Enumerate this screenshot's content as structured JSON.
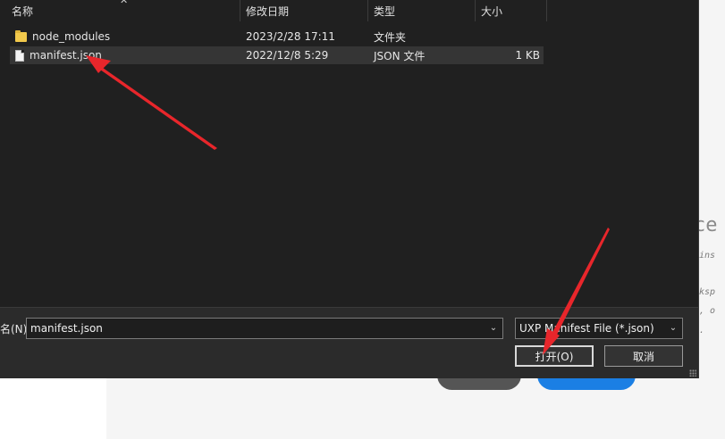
{
  "columns": {
    "name": "名称",
    "date_modified": "修改日期",
    "type": "类型",
    "size": "大小"
  },
  "files": [
    {
      "name": "node_modules",
      "date": "2023/2/28 17:11",
      "type": "文件夹",
      "size": "",
      "icon": "folder-icon"
    },
    {
      "name": "manifest.json",
      "date": "2022/12/8 5:29",
      "type": "JSON 文件",
      "size": "1 KB",
      "icon": "file-icon"
    }
  ],
  "dialog": {
    "filename_label": "名(N):",
    "filename_value": "manifest.json",
    "filetype_value": "UXP Manifest File (*.json)",
    "open_button": "打开(O)",
    "cancel_button": "取消"
  },
  "background": {
    "heading_fragment": "ce",
    "mono_lines": [
      "gins",
      "rksp",
      "), o",
      "e."
    ]
  },
  "colors": {
    "annotation_arrow": "#e8262b",
    "selected_row": "#353535",
    "dialog_bg": "#202020",
    "primary_button": "#1b7fe4"
  }
}
